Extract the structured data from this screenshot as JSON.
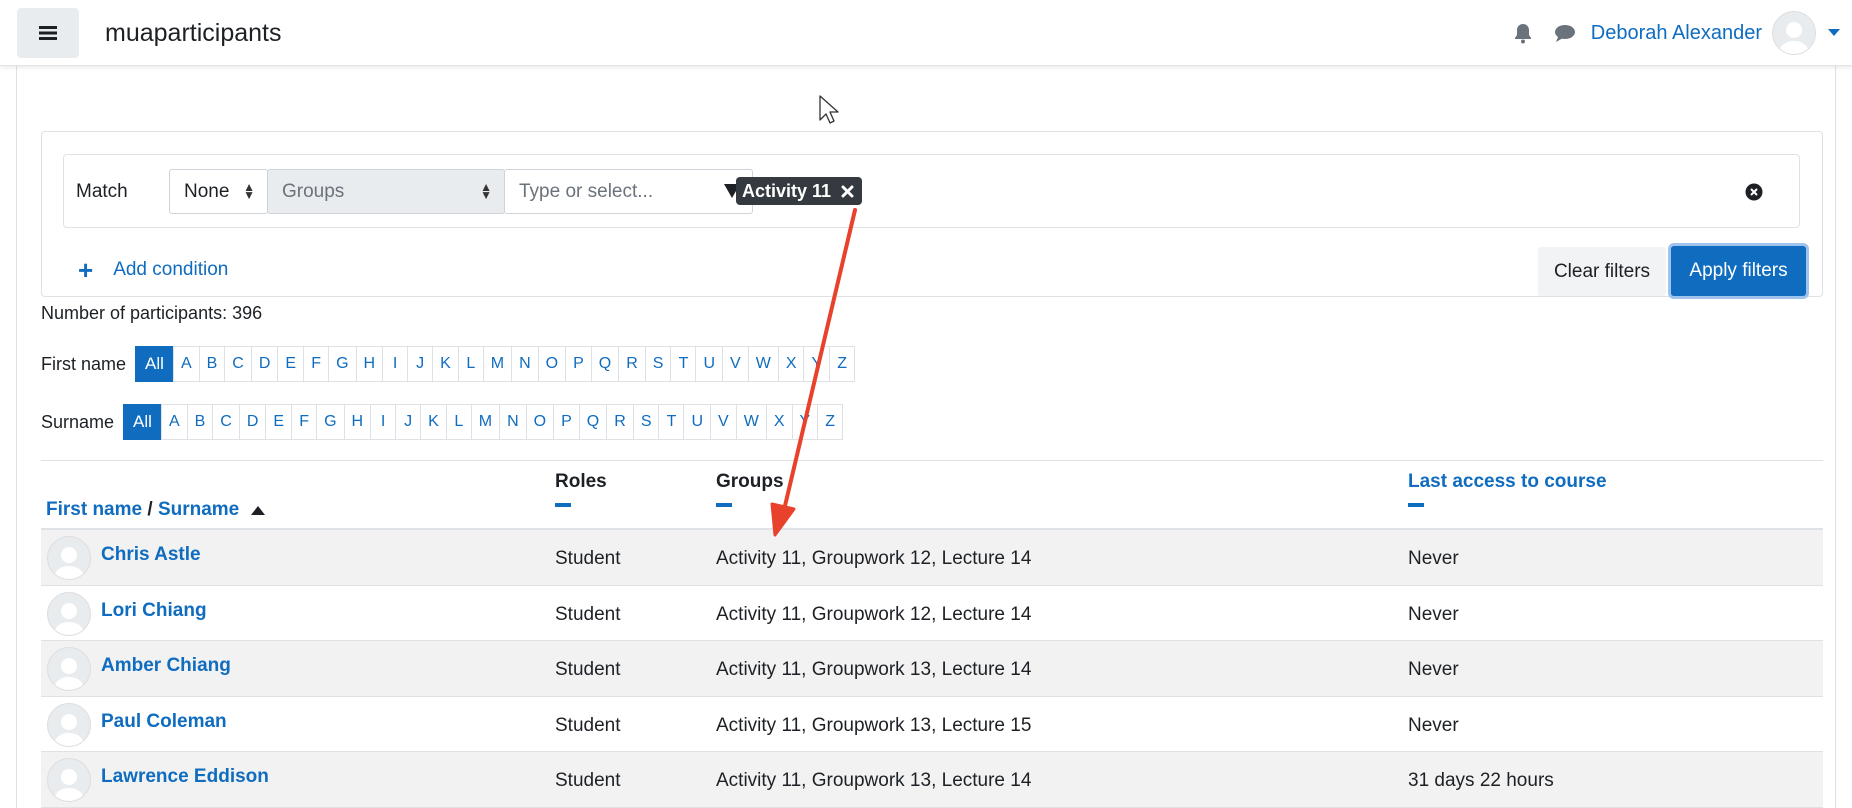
{
  "header": {
    "site_name": "muaparticipants",
    "user_name": "Deborah Alexander",
    "icons": {
      "menu": "hamburger-icon",
      "notifications": "bell-icon",
      "messages": "speech-bubble-icon",
      "user_menu": "chevron-down-icon"
    }
  },
  "filter": {
    "match_label": "Match",
    "match_value": "None",
    "type_value": "Groups",
    "value_placeholder": "Type or select...",
    "selected_chip": "Activity 11",
    "add_condition": "Add condition",
    "clear_filters": "Clear filters",
    "apply_filters": "Apply filters"
  },
  "participants_count": "Number of participants: 396",
  "initials": {
    "first_name_label": "First name",
    "surname_label": "Surname",
    "all_label": "All",
    "letters": [
      "A",
      "B",
      "C",
      "D",
      "E",
      "F",
      "G",
      "H",
      "I",
      "J",
      "K",
      "L",
      "M",
      "N",
      "O",
      "P",
      "Q",
      "R",
      "S",
      "T",
      "U",
      "V",
      "W",
      "X",
      "Y",
      "Z"
    ]
  },
  "table": {
    "col_first_name": "First name",
    "col_separator": "/",
    "col_surname": "Surname",
    "col_roles": "Roles",
    "col_groups": "Groups",
    "col_last_access": "Last access to course",
    "rows": [
      {
        "name": "Chris Astle",
        "role": "Student",
        "groups": "Activity 11, Groupwork 12, Lecture 14",
        "last_access": "Never"
      },
      {
        "name": "Lori Chiang",
        "role": "Student",
        "groups": "Activity 11, Groupwork 12, Lecture 14",
        "last_access": "Never"
      },
      {
        "name": "Amber Chiang",
        "role": "Student",
        "groups": "Activity 11, Groupwork 13, Lecture 14",
        "last_access": "Never"
      },
      {
        "name": "Paul Coleman",
        "role": "Student",
        "groups": "Activity 11, Groupwork 13, Lecture 15",
        "last_access": "Never"
      },
      {
        "name": "Lawrence Eddison",
        "role": "Student",
        "groups": "Activity 11, Groupwork 13, Lecture 14",
        "last_access": "31 days 22 hours"
      }
    ]
  },
  "colors": {
    "link": "#0f6cbf",
    "chip": "#343a40",
    "arrow": "#e8412c"
  }
}
